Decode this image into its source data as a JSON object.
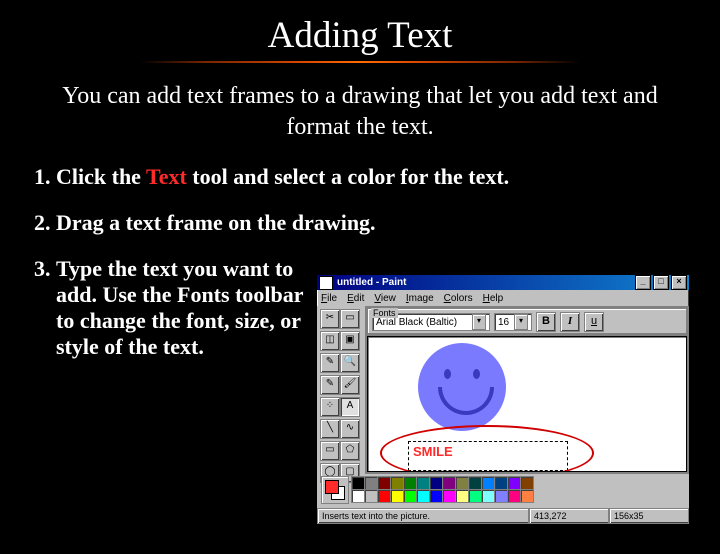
{
  "title": "Adding Text",
  "intro": "You can add text frames to a drawing that let you add text and format the text.",
  "steps": {
    "s1a": "Click the ",
    "s1b": "Text",
    "s1c": " tool and select a color for the text.",
    "s2": "Drag a text frame on the drawing.",
    "s3": "Type the text you want to add. Use the Fonts toolbar to change the font, size, or style of the text."
  },
  "paint": {
    "title": "untitled - Paint",
    "menu": {
      "file": "File",
      "edit": "Edit",
      "view": "View",
      "image": "Image",
      "colors": "Colors",
      "help": "Help"
    },
    "fontbar_label": "Fonts",
    "font_name": "Arial Black (Baltic)",
    "font_size": "16",
    "bold": "B",
    "italic": "I",
    "under": "u",
    "text_entry": "SMILE",
    "status_msg": "Inserts text into the picture.",
    "coord": "413,272",
    "dim": "156x35",
    "winbtn": {
      "min": "_",
      "max": "□",
      "close": "×"
    },
    "tool": {
      "freeform": "✂",
      "select": "▭",
      "eraser": "◫",
      "fill": "▣",
      "picker": "✎",
      "zoom": "🔍",
      "pencil": "✎",
      "brush": "🖌",
      "spray": "⁘",
      "text": "A",
      "line": "╲",
      "curve": "∿",
      "rect": "▭",
      "poly": "⬠",
      "ellipse": "◯",
      "round": "▢"
    }
  },
  "palette": [
    "#000000",
    "#808080",
    "#800000",
    "#808000",
    "#008000",
    "#008080",
    "#000080",
    "#800080",
    "#808040",
    "#004040",
    "#0080ff",
    "#004080",
    "#8000ff",
    "#804000",
    "#ffffff",
    "#c0c0c0",
    "#ff0000",
    "#ffff00",
    "#00ff00",
    "#00ffff",
    "#0000ff",
    "#ff00ff",
    "#ffff80",
    "#00ff80",
    "#80ffff",
    "#8080ff",
    "#ff0080",
    "#ff8040"
  ]
}
